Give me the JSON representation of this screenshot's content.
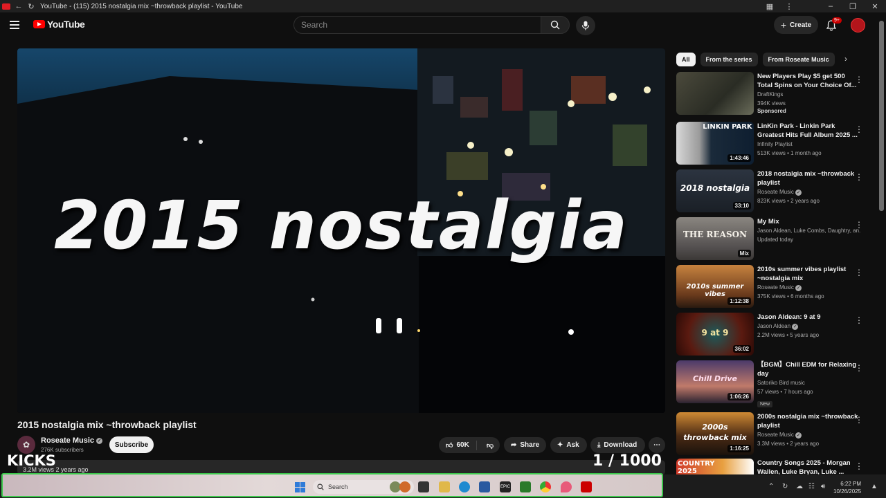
{
  "browser": {
    "tab_title": "YouTube - (115) 2015 nostalgia mix ~throwback playlist - YouTube"
  },
  "masthead": {
    "logo_text": "YouTube",
    "search_placeholder": "Search",
    "create_label": "Create",
    "notification_count": "9+"
  },
  "player": {
    "overlay_title": "2015 nostalgia"
  },
  "video": {
    "title": "2015 nostalgia mix ~throwback playlist",
    "channel": "Roseate Music",
    "subscribers": "276K subscribers",
    "subscribe_label": "Subscribe",
    "likes": "60K",
    "share_label": "Share",
    "ask_label": "Ask",
    "download_label": "Download",
    "views_date": "3.2M views  2 years ago"
  },
  "overlay": {
    "left_text": "KICKS",
    "counter": "1  / 1000"
  },
  "chips": [
    "All",
    "From the series",
    "From Roseate Music"
  ],
  "recommendations": [
    {
      "title": "New Players Play $5 get 500 Total Spins on Your Choice Of...",
      "channel": "DraftKings",
      "meta": "394K views",
      "badge": "Sponsored",
      "duration": "",
      "thumb_text": ""
    },
    {
      "title": "LinKin Park - Linkin Park Greatest Hits Full Album 2025 ...",
      "channel": "Infinity Playlist",
      "meta": "513K views • 1 month ago",
      "duration": "1:43:46",
      "thumb_text": "LINKIN PARK"
    },
    {
      "title": "2018 nostalgia mix ~throwback playlist",
      "channel": "Roseate Music",
      "meta": "823K views • 2 years ago",
      "duration": "33:10",
      "thumb_text": "2018 nostalgia"
    },
    {
      "title": "My Mix",
      "channel": "Jason Aldean, Luke Combs, Daughtry, an...",
      "meta": "Updated today",
      "duration": "Mix",
      "thumb_text": "THE REASON"
    },
    {
      "title": "2010s summer vibes playlist ~nostalgia mix",
      "channel": "Roseate Music",
      "meta": "375K views • 6 months ago",
      "duration": "1:12:38",
      "thumb_text": "2010s summer vibes"
    },
    {
      "title": "Jason Aldean: 9 at 9",
      "channel": "Jason Aldean",
      "meta": "2.2M views • 5 years ago",
      "duration": "36:02",
      "thumb_text": "9 at 9"
    },
    {
      "title": "【BGM】Chill EDM for Relaxing day",
      "channel": "Satoriko Bird music",
      "meta": "57 views • 7 hours ago",
      "badge": "New",
      "duration": "1:06:26",
      "thumb_text": "Chill Drive"
    },
    {
      "title": "2000s nostalgia mix ~throwback playlist",
      "channel": "Roseate Music",
      "meta": "3.3M views • 2 years ago",
      "duration": "1:16:25",
      "thumb_text": "2000s throwback mix"
    },
    {
      "title": "Country Songs 2025 - Morgan Wallen, Luke Bryan, Luke ...",
      "channel": "",
      "meta": "",
      "duration": "",
      "thumb_text": "COUNTRY 2025"
    }
  ],
  "taskbar": {
    "search_label": "Search",
    "time": "6:22 PM",
    "date": "10/26/2025"
  }
}
